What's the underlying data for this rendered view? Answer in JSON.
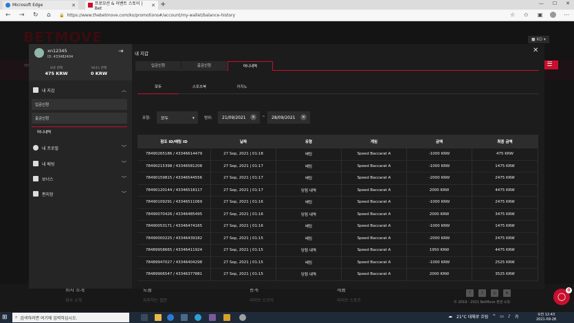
{
  "browser": {
    "tabs": [
      {
        "title": "Microsoft Edge",
        "active": false
      },
      {
        "title": "프로모션 & 이벤트 스토어 | Bet",
        "active": true
      }
    ],
    "new_tab": "+",
    "url": "https://www.thebetmove.com/ko/promotions#/account/my-wallet/balance-history"
  },
  "site": {
    "logo": "BETMOVE",
    "lang": "KO",
    "bg_text": "라이",
    "footer": {
      "cols": [
        {
          "title": "회사 소개",
          "sub": "회사 소개"
        },
        {
          "title": "도움",
          "sub": "자주하는 질문"
        },
        {
          "title": "통계",
          "sub": "라이브 스코어"
        },
        {
          "title": "제품",
          "sub": "라이브 스포츠"
        }
      ],
      "copyright": "© 2019 - 2021 BetMove 판권 소유.",
      "chat_badge": "0"
    }
  },
  "user": {
    "name": "xn12345",
    "id": "ID: 433482404",
    "balance_label": "보유 잔액",
    "balance": "475 KRW",
    "bonus_label": "보너스 잔액",
    "bonus": "0 KRW"
  },
  "sidebar": {
    "wallet": "내 지갑",
    "sub": [
      "입금신청",
      "출금신청",
      "머니내역"
    ],
    "sections": [
      "내 프로필",
      "내 배팅",
      "보너스",
      "편지함"
    ]
  },
  "modal": {
    "title": "내 지갑",
    "tabs": [
      "입금신청",
      "출금신청",
      "머니내역"
    ],
    "subtabs": [
      "모두",
      "스포츠북",
      "카지노"
    ],
    "filter": {
      "type_label": "유형:",
      "type_value": "모두",
      "range_label": "범위:",
      "date_from": "21/09/2021",
      "date_sep": "~",
      "date_to": "28/09/2021"
    },
    "table": {
      "headers": [
        "참조 ID/배팅 ID",
        "날짜",
        "유형",
        "게임",
        "금액",
        "최종 금액"
      ],
      "rows": [
        [
          "78490265186 / 43346614479",
          "27 Sep, 2021 | 01:18",
          "배팅",
          "Speed Baccarat A",
          "-1000 KRW",
          "475 KRW"
        ],
        [
          "78490215398 / 43346581208",
          "27 Sep, 2021 | 01:17",
          "배팅",
          "Speed Baccarat A",
          "-1000 KRW",
          "1475 KRW"
        ],
        [
          "78490159815 / 43346544556",
          "27 Sep, 2021 | 01:17",
          "배팅",
          "Speed Baccarat A",
          "-2000 KRW",
          "2475 KRW"
        ],
        [
          "78490120144 / 43346518117",
          "27 Sep, 2021 | 01:17",
          "당첨 내역",
          "Speed Baccarat A",
          "2000 KRW",
          "4475 KRW"
        ],
        [
          "78490109291 / 43346511069",
          "27 Sep, 2021 | 01:16",
          "배팅",
          "Speed Baccarat A",
          "-1000 KRW",
          "2475 KRW"
        ],
        [
          "78490070426 / 43346485495",
          "27 Sep, 2021 | 01:16",
          "당첨 내역",
          "Speed Baccarat A",
          "2000 KRW",
          "3475 KRW"
        ],
        [
          "78490053171 / 43346474165",
          "27 Sep, 2021 | 01:16",
          "배팅",
          "Speed Baccarat A",
          "-1000 KRW",
          "1475 KRW"
        ],
        [
          "78490000225 / 43346439182",
          "27 Sep, 2021 | 01:15",
          "배팅",
          "Speed Baccarat A",
          "-2000 KRW",
          "2475 KRW"
        ],
        [
          "78489958665 / 43346411924",
          "27 Sep, 2021 | 01:15",
          "당첨 내역",
          "Speed Baccarat A",
          "1950 KRW",
          "4475 KRW"
        ],
        [
          "78489947027 / 43346404298",
          "27 Sep, 2021 | 01:15",
          "배팅",
          "Speed Baccarat A",
          "-1000 KRW",
          "2525 KRW"
        ],
        [
          "78489906547 / 43346377881",
          "27 Sep, 2021 | 01:15",
          "당첨 내역",
          "Speed Baccarat A",
          "2000 KRW",
          "3525 KRW"
        ]
      ]
    }
  },
  "taskbar": {
    "search": "검색하려면 여기에 입력하십시오.",
    "weather": "21°C 대체로 흐림",
    "time": "오전 12:43",
    "date": "2021-09-28"
  },
  "colors": {
    "accent": "#c8102e",
    "panel": "#1c1c1c",
    "sidebar": "#252525"
  }
}
